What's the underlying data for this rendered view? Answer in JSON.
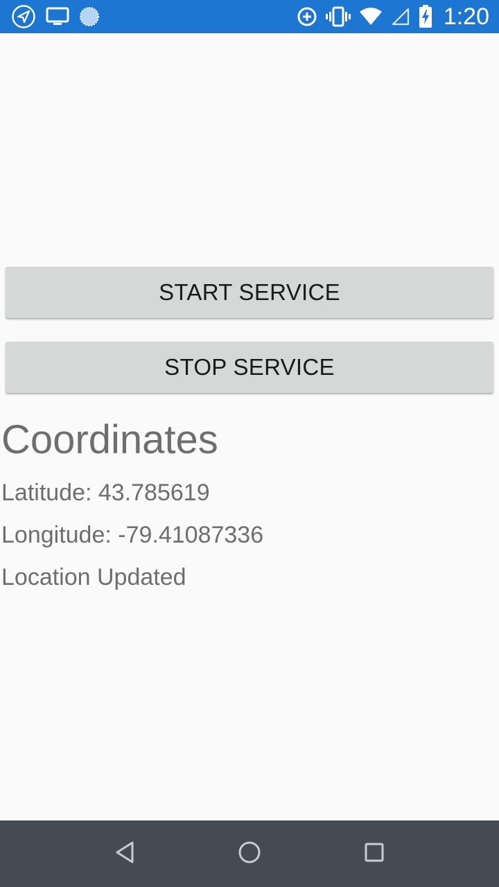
{
  "status_bar": {
    "time": "1:20",
    "background": "#1e76d3",
    "icons_left": [
      "navigation-icon",
      "cast-screen-icon",
      "sync-circle-icon"
    ],
    "icons_right": [
      "data-saver-icon",
      "vibrate-icon",
      "wifi-icon",
      "signal-icon",
      "battery-charging-icon"
    ]
  },
  "buttons": {
    "start_label": "START SERVICE",
    "stop_label": "STOP SERVICE"
  },
  "coordinates": {
    "title": "Coordinates",
    "latitude_text": "Latitude: 43.785619",
    "longitude_text": "Longitude: -79.41087336",
    "status_text": "Location Updated"
  },
  "nav_bar": {
    "background": "#454b52",
    "icons": [
      "back-icon",
      "home-icon",
      "recents-icon"
    ]
  }
}
